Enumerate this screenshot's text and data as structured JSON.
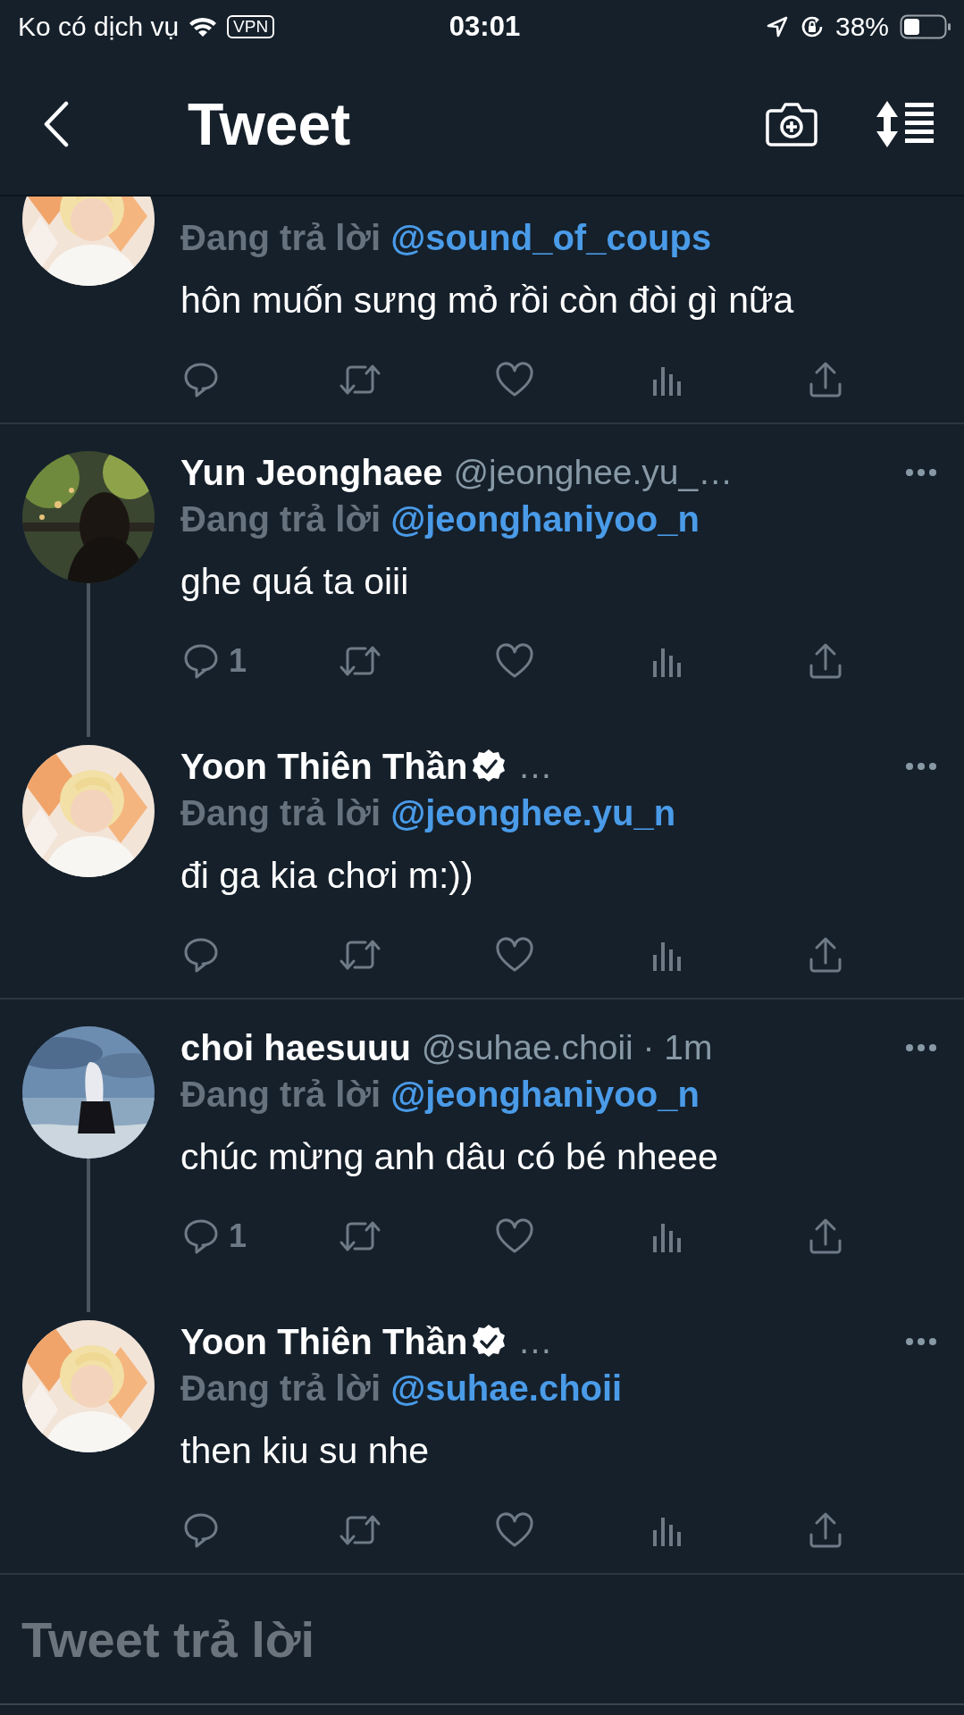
{
  "status_bar": {
    "carrier": "Ko có dịch vụ",
    "vpn": "VPN",
    "time": "03:01",
    "battery": "38%"
  },
  "header": {
    "title": "Tweet"
  },
  "tweets": [
    {
      "kind": "clipped",
      "replying_label": "Đang trả lời",
      "reply_to": "@sound_of_coups",
      "text": "hôn muốn sưng mỏ rồi còn đòi gì nữa",
      "thread_line": false,
      "divider_after": true
    },
    {
      "kind": "full",
      "name": "Yun Jeonghaee",
      "verified": false,
      "handle": "@jeonghee.yu_…",
      "replying_label": "Đang trả lời",
      "reply_to": "@jeonghaniyoo_n",
      "text": "ghe quá ta oiii",
      "reply_count": "1",
      "thread_line": true,
      "divider_after": false
    },
    {
      "kind": "full",
      "name": "Yoon Thiên Thần",
      "verified": true,
      "handle": "…",
      "replying_label": "Đang trả lời",
      "reply_to": "@jeonghee.yu_n",
      "text": "đi ga kia chơi m:))",
      "thread_line": false,
      "divider_after": true
    },
    {
      "kind": "full",
      "name": "choi haesuuu",
      "verified": false,
      "handle": "@suhae.choii · 1m",
      "replying_label": "Đang trả lời",
      "reply_to": "@jeonghaniyoo_n",
      "text": "chúc mừng anh dâu có bé nheee",
      "reply_count": "1",
      "thread_line": true,
      "divider_after": false
    },
    {
      "kind": "full",
      "name": "Yoon Thiên Thần",
      "verified": true,
      "handle": "…",
      "replying_label": "Đang trả lời",
      "reply_to": "@suhae.choii",
      "text": "then kiu su nhe",
      "thread_line": false,
      "divider_after": true
    }
  ],
  "reply_box": {
    "placeholder": "Tweet trả lời"
  }
}
